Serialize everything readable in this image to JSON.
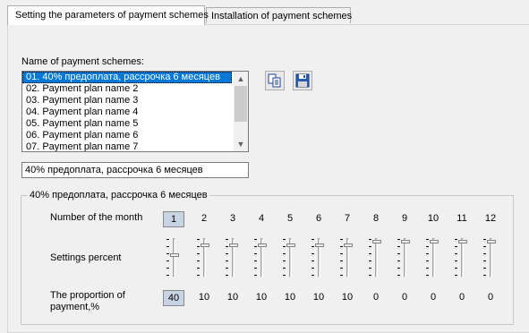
{
  "tabs": [
    {
      "label": "Setting the parameters of payment schemes",
      "active": true
    },
    {
      "label": "Installation of payment schemes",
      "active": false
    }
  ],
  "schemes_label": "Name of payment schemes:",
  "schemes": [
    "01. 40% предоплата, рассрочка 6 месяцев",
    "02. Payment plan name 2",
    "03. Payment plan name 3",
    "04. Payment plan name 4",
    "05. Payment plan name 5",
    "06. Payment plan name 6",
    "07. Payment plan name 7"
  ],
  "selected_scheme_index": 0,
  "icons": {
    "copy": "copy-icon",
    "save": "save-icon"
  },
  "name_field_value": "40% предоплата, рассрочка 6 месяцев",
  "group_title": "40% предоплата, рассрочка 6 месяцев",
  "row_labels": {
    "month": "Number of the month",
    "settings": "Settings percent",
    "proportion": "The proportion of payment,%"
  },
  "months": [
    "1",
    "2",
    "3",
    "4",
    "5",
    "6",
    "7",
    "8",
    "9",
    "10",
    "11",
    "12"
  ],
  "selected_month_index": 0,
  "proportions": [
    "40",
    "10",
    "10",
    "10",
    "10",
    "10",
    "10",
    "0",
    "0",
    "0",
    "0",
    "0"
  ],
  "colors": {
    "selection": "#0078d7",
    "accent_cell": "#c8d4e3"
  }
}
